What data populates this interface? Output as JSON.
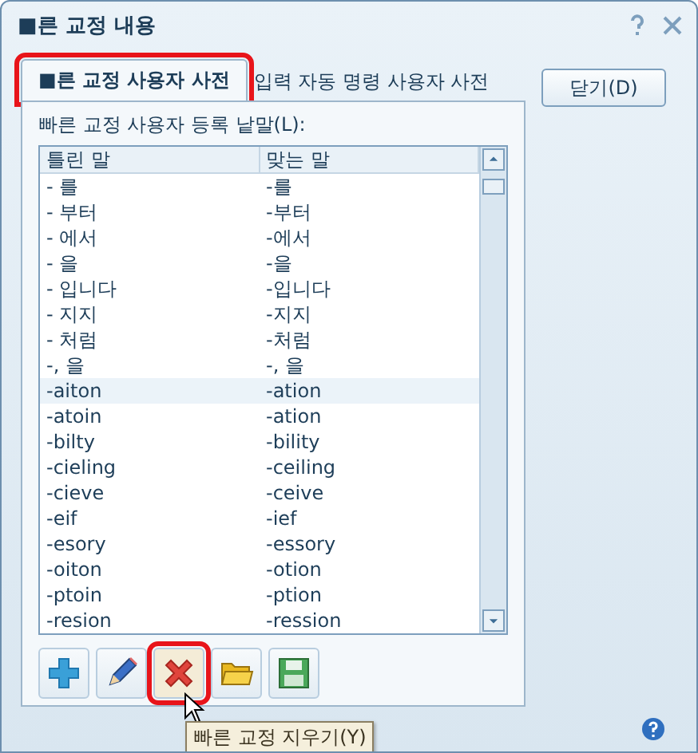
{
  "window": {
    "title": "■른 교정 내용"
  },
  "tabs": [
    {
      "label": "■른 교정 사용자 사전",
      "selected": true,
      "highlighted": true
    },
    {
      "label": "입력 자동 명령 사용자 사전",
      "selected": false,
      "highlighted": false
    }
  ],
  "close_button": "닫기(D)",
  "list_label": "빠른 교정 사용자 등록 낱말(L):",
  "table": {
    "columns": [
      "틀린 말",
      "맞는 말"
    ],
    "rows": [
      {
        "cells": [
          "- 를",
          "-를"
        ],
        "selected": false
      },
      {
        "cells": [
          "- 부터",
          "-부터"
        ],
        "selected": false
      },
      {
        "cells": [
          "- 에서",
          "-에서"
        ],
        "selected": false
      },
      {
        "cells": [
          "- 을",
          "-을"
        ],
        "selected": false
      },
      {
        "cells": [
          "- 입니다",
          "-입니다"
        ],
        "selected": false
      },
      {
        "cells": [
          "- 지지",
          "-지지"
        ],
        "selected": false
      },
      {
        "cells": [
          "- 처럼",
          "-처럼"
        ],
        "selected": false
      },
      {
        "cells": [
          "-, 을",
          "-, 을"
        ],
        "selected": false
      },
      {
        "cells": [
          "-aiton",
          "-ation"
        ],
        "selected": true
      },
      {
        "cells": [
          "-atoin",
          "-ation"
        ],
        "selected": false
      },
      {
        "cells": [
          "-bilty",
          "-bility"
        ],
        "selected": false
      },
      {
        "cells": [
          "-cieling",
          "-ceiling"
        ],
        "selected": false
      },
      {
        "cells": [
          "-cieve",
          "-ceive"
        ],
        "selected": false
      },
      {
        "cells": [
          "-eif",
          "-ief"
        ],
        "selected": false
      },
      {
        "cells": [
          "-esory",
          "-essory"
        ],
        "selected": false
      },
      {
        "cells": [
          "-oiton",
          "-otion"
        ],
        "selected": false
      },
      {
        "cells": [
          "-ptoin",
          "-ption"
        ],
        "selected": false
      },
      {
        "cells": [
          "-resion",
          "-ression"
        ],
        "selected": false
      }
    ]
  },
  "toolbar": [
    {
      "kind": "add",
      "highlighted": false
    },
    {
      "kind": "edit",
      "highlighted": false
    },
    {
      "kind": "delete",
      "highlighted": true
    },
    {
      "kind": "open",
      "highlighted": false
    },
    {
      "kind": "save",
      "highlighted": false
    }
  ],
  "tooltip": "빠른 교정 지우기(Y)"
}
